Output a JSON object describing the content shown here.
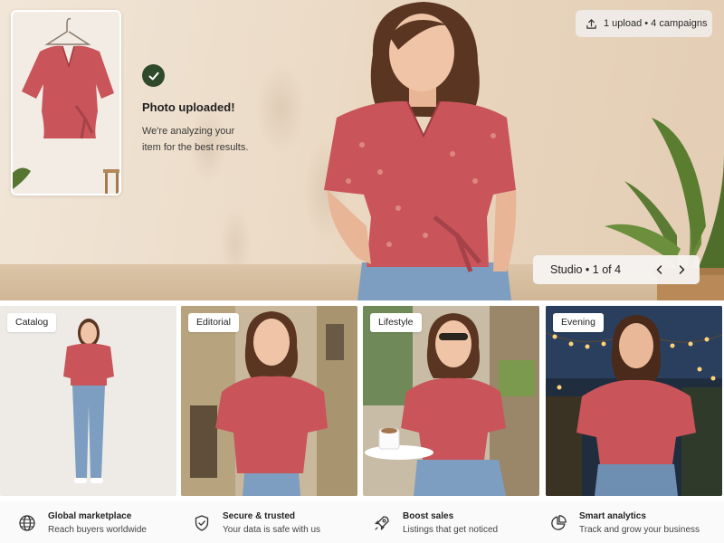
{
  "hero": {
    "upload_status": {
      "title": "Photo uploaded!",
      "message": "We're analyzing your item for the best results."
    },
    "top_pill": {
      "icon": "upload-icon",
      "text": "1 upload • 4 campaigns"
    },
    "studio_nav": {
      "label": "Studio • 1 of 4",
      "prev_icon": "chevron-left-icon",
      "next_icon": "chevron-right-icon"
    }
  },
  "styles": [
    {
      "label": "Catalog"
    },
    {
      "label": "Editorial"
    },
    {
      "label": "Lifestyle"
    },
    {
      "label": "Evening"
    }
  ],
  "features": [
    {
      "icon": "globe-icon",
      "title": "Global marketplace",
      "desc": "Reach buyers worldwide"
    },
    {
      "icon": "shield-check-icon",
      "title": "Secure & trusted",
      "desc": "Your data is safe with us"
    },
    {
      "icon": "rocket-icon",
      "title": "Boost sales",
      "desc": "Listings that get noticed"
    },
    {
      "icon": "pie-chart-icon",
      "title": "Smart analytics",
      "desc": "Track and grow your business"
    }
  ],
  "colors": {
    "blouse": "#c9555a",
    "check_badge": "#2f4a2a",
    "jeans": "#7d9ec1"
  }
}
